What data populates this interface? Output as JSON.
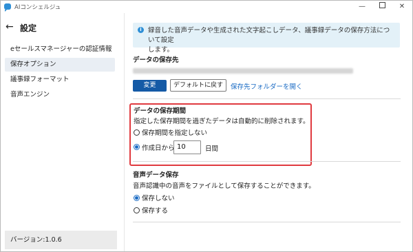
{
  "window": {
    "title": "AIコンシェルジュ"
  },
  "sidebar": {
    "title": "設定",
    "items": [
      {
        "label": "eセールスマネージャーの認証情報",
        "active": false
      },
      {
        "label": "保存オプション",
        "active": true
      },
      {
        "label": "議事録フォーマット",
        "active": false
      },
      {
        "label": "音声エンジン",
        "active": false
      }
    ],
    "version": "バージョン:1.0.6"
  },
  "main": {
    "info": {
      "line1": "録音した音声データや生成された文字起こしデータ、議事録データの保存方法について設定",
      "line2": "します。"
    },
    "save_location": {
      "label": "データの保存先",
      "change_button": "変更",
      "default_button": "デフォルトに戻す",
      "open_folder_link": "保存先フォルダーを開く"
    },
    "retention": {
      "label": "データの保存期間",
      "description": "指定した保存期間を過ぎたデータは自動的に削除されます。",
      "option_none": "保存期間を指定しない",
      "option_from": "作成日から",
      "days_value": "10",
      "days_unit": "日間",
      "selected": "from"
    },
    "audio": {
      "label": "音声データ保存",
      "description": "音声認識中の音声をファイルとして保存することができます。",
      "option_no": "保存しない",
      "option_yes": "保存する",
      "selected": "no"
    }
  },
  "colors": {
    "accent": "#145aa6",
    "link": "#1a6bc4",
    "info_bg": "#e3f1f8",
    "highlight_border": "#e0393e",
    "nav_active_bg": "#e9eef4"
  }
}
